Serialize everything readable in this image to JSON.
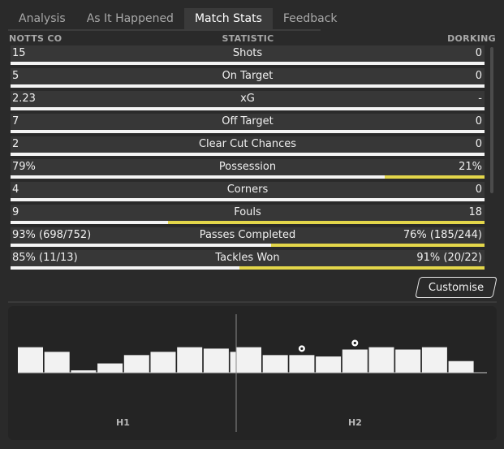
{
  "tabs": [
    {
      "label": "Analysis",
      "active": false
    },
    {
      "label": "As It Happened",
      "active": false
    },
    {
      "label": "Match Stats",
      "active": true
    },
    {
      "label": "Feedback",
      "active": false
    }
  ],
  "header": {
    "home_team": "NOTTS CO",
    "statistic": "STATISTIC",
    "away_team": "DORKING"
  },
  "stats": [
    {
      "label": "Shots",
      "home": "15",
      "away": "0",
      "away_share": 0
    },
    {
      "label": "On Target",
      "home": "5",
      "away": "0",
      "away_share": 0
    },
    {
      "label": "xG",
      "home": "2.23",
      "away": "-",
      "away_share": 0
    },
    {
      "label": "Off Target",
      "home": "7",
      "away": "0",
      "away_share": 0
    },
    {
      "label": "Clear Cut Chances",
      "home": "2",
      "away": "0",
      "away_share": 0
    },
    {
      "label": "Possession",
      "home": "79%",
      "away": "21%",
      "away_share": 0.21
    },
    {
      "label": "Corners",
      "home": "4",
      "away": "0",
      "away_share": 0
    },
    {
      "label": "Fouls",
      "home": "9",
      "away": "18",
      "away_share": 0.667
    },
    {
      "label": "Passes Completed",
      "home": "93% (698/752)",
      "away": "76% (185/244)",
      "away_share": 0.45
    },
    {
      "label": "Tackles Won",
      "home": "85% (11/13)",
      "away": "91% (20/22)",
      "away_share": 0.517
    }
  ],
  "customise_label": "Customise",
  "timeline": {
    "halves": [
      "H1",
      "H2"
    ],
    "h1_momentum": [
      0.55,
      0.45,
      0.05,
      0.2,
      0.38,
      0.45,
      0.55,
      0.52,
      0.45
    ],
    "h2_momentum": [
      0.55,
      0.38,
      0.38,
      0.35,
      0.5,
      0.55,
      0.5,
      0.55,
      0.25
    ],
    "goal_icon": "football-icon",
    "goal_intervals_h2": [
      2,
      4
    ]
  },
  "colors": {
    "accent": "#e3d64a",
    "bar_bg": "#373737",
    "track": "#f4f4f4"
  }
}
